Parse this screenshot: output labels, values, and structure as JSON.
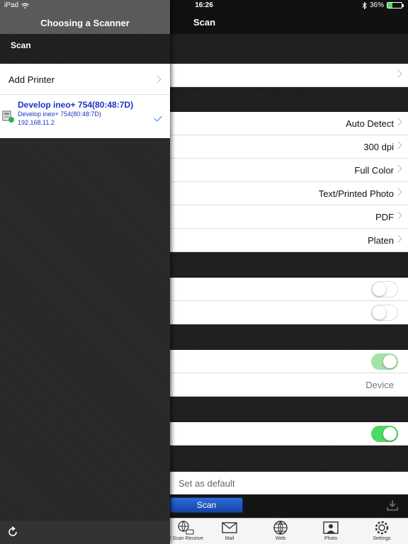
{
  "status": {
    "device": "iPad",
    "time": "16:26",
    "battery": "36%"
  },
  "left_panel": {
    "title": "Choosing a Scanner",
    "section_label": "Scan",
    "add_printer_label": "Add Printer",
    "printer": {
      "name": "Develop ineo+ 754(80:48:7D)",
      "model": "Develop ineo+ 754(80:48:7D)",
      "ip": "192.168.11.2",
      "selected": true
    }
  },
  "main": {
    "title": "Scan",
    "settings": [
      {
        "value": "Auto Detect"
      },
      {
        "value": "300 dpi"
      },
      {
        "value": "Full Color"
      },
      {
        "value": "Text/Printed Photo"
      },
      {
        "value": "PDF"
      },
      {
        "value": "Platen"
      }
    ],
    "storage_value": "Device",
    "set_default_label": "Set as default",
    "scan_button_label": "Scan"
  },
  "tabs": [
    {
      "label": "V Scan Receive",
      "icon": "scan-receive-icon"
    },
    {
      "label": "Mail",
      "icon": "mail-icon"
    },
    {
      "label": "Web",
      "icon": "globe-icon"
    },
    {
      "label": "Photo",
      "icon": "photo-icon"
    },
    {
      "label": "Settings",
      "icon": "gear-icon"
    }
  ],
  "colors": {
    "accent_blue": "#1a32c8",
    "toggle_on": "#4cd964",
    "toggle_on_dimmed": "#a3e3a8",
    "scan_button": "#1f55c0"
  }
}
